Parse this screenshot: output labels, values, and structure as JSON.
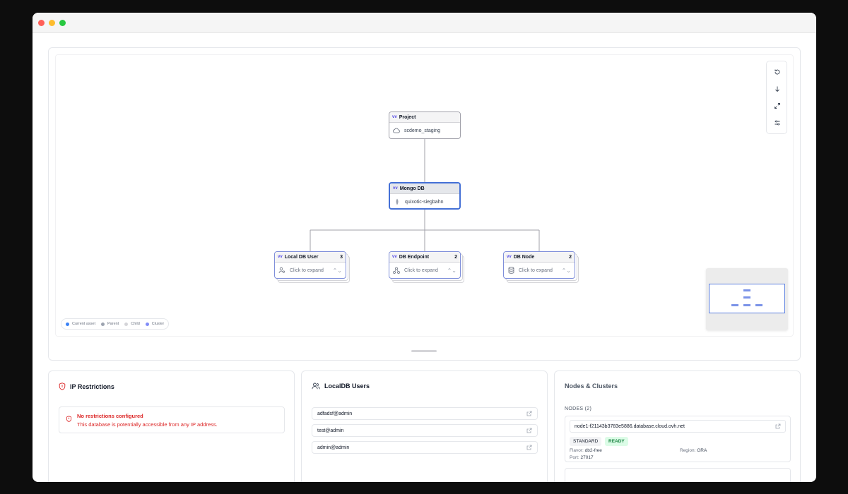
{
  "graph": {
    "nodes": {
      "project": {
        "type_label": "Project",
        "name": "scdemo_staging",
        "icon": "cloud-icon"
      },
      "mongo": {
        "type_label": "Mongo DB",
        "name": "quixotic-siegbahn",
        "icon": "mongodb-leaf-icon"
      },
      "local_db_user": {
        "type_label": "Local DB User",
        "count": "3",
        "body": "Click to expand",
        "icon": "users-icon"
      },
      "db_endpoint": {
        "type_label": "DB Endpoint",
        "count": "2",
        "body": "Click to expand",
        "icon": "endpoint-icon"
      },
      "db_node": {
        "type_label": "DB Node",
        "count": "2",
        "body": "Click to expand",
        "icon": "database-icon"
      }
    },
    "brand_mark": "vv",
    "toolbar": [
      "reset-icon",
      "arrow-down-icon",
      "fullscreen-icon",
      "settings-sliders-icon"
    ],
    "legend": [
      {
        "label": "Current asset",
        "color": "#3b82f6"
      },
      {
        "label": "Parent",
        "color": "#9ca3af"
      },
      {
        "label": "Child",
        "color": "#d4d4d8"
      },
      {
        "label": "Cluster",
        "color": "#818cf8"
      }
    ]
  },
  "ip_restrictions": {
    "title": "IP Restrictions",
    "alert_title": "No restrictions configured",
    "alert_text": "This database is potentially accessible from any IP address."
  },
  "localdb_users": {
    "title": "LocalDB Users",
    "users": [
      "adfadsf@admin",
      "test@admin",
      "admin@admin"
    ]
  },
  "nodes_clusters": {
    "title": "Nodes & Clusters",
    "nodes_label": "NODES (2)",
    "nodes": [
      {
        "host": "node1-f21143b3783e5886.database.cloud.ovh.net",
        "tier": "STANDARD",
        "status": "READY",
        "flavor_label": "Flavor:",
        "flavor": "db2-free",
        "region_label": "Region:",
        "region": "GRA",
        "port_label": "Port:",
        "port": "27017"
      }
    ]
  },
  "colors": {
    "current": "#4470d6",
    "cluster": "#7f8fda",
    "danger": "#dc2626",
    "ready_bg": "#dcfce7",
    "ready_fg": "#15803d"
  }
}
